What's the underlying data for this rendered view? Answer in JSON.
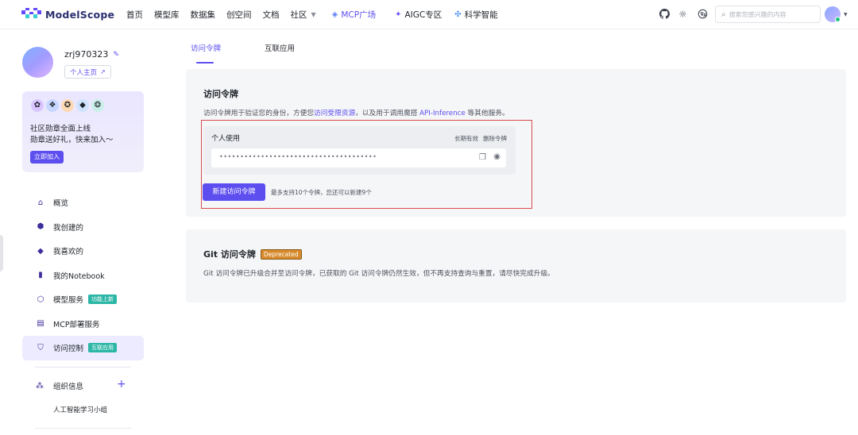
{
  "brand": {
    "name": "ModelScope"
  },
  "nav": {
    "items": [
      {
        "label": "首页"
      },
      {
        "label": "模型库"
      },
      {
        "label": "数据集"
      },
      {
        "label": "创空间"
      },
      {
        "label": "文档"
      },
      {
        "label": "社区"
      }
    ],
    "mcp": "MCP广场",
    "aigc": "AIGC专区",
    "science": "科学智能"
  },
  "search": {
    "placeholder": "搜索您感兴趣的内容"
  },
  "profile": {
    "username": "zrj970323",
    "homepage_label": "个人主页"
  },
  "badge_card": {
    "line1": "社区勋章全面上线",
    "line2": "勋章送好礼，快来加入～",
    "join_label": "立即加入"
  },
  "sidebar": {
    "items": [
      {
        "label": "概览"
      },
      {
        "label": "我创建的"
      },
      {
        "label": "我喜欢的"
      },
      {
        "label": "我的Notebook"
      },
      {
        "label": "模型服务",
        "tag": "功能上新"
      },
      {
        "label": "MCP部署服务"
      },
      {
        "label": "访问控制",
        "tag": "互联应用"
      }
    ],
    "org_title": "组织信息",
    "org_item": "人工智能学习小组"
  },
  "tabs": [
    {
      "label": "访问令牌"
    },
    {
      "label": "互联应用"
    }
  ],
  "access_token": {
    "title": "访问令牌",
    "desc_prefix": "访问令牌用于验证您的身份，方便您",
    "desc_link1": "访问受限资源",
    "desc_middle": "，以及用于调用魔搭 ",
    "desc_link2": "API-Inference",
    "desc_suffix": " 等其他服务。",
    "card": {
      "title": "个人使用",
      "validity": "长期有效",
      "delete": "删除令牌",
      "token_masked": "••••••••••••••••••••••••••••••••••••••"
    },
    "new_button": "新建访问令牌",
    "hint": "最多支持10个令牌，您还可以新建9个"
  },
  "git_token": {
    "title": "Git 访问令牌",
    "badge": "Deprecated",
    "desc": "Git 访问令牌已升级合并至访问令牌，已获取的 Git 访问令牌仍然生效，但不再支持查询与重置，请尽快完成升级。"
  },
  "colors": {
    "accent": "#5d4ef0",
    "teal_tag": "#2bb6a5",
    "deprecated": "#d68a2b",
    "highlight_box": "#d94b4b",
    "panel_bg": "#f5f6f8"
  }
}
